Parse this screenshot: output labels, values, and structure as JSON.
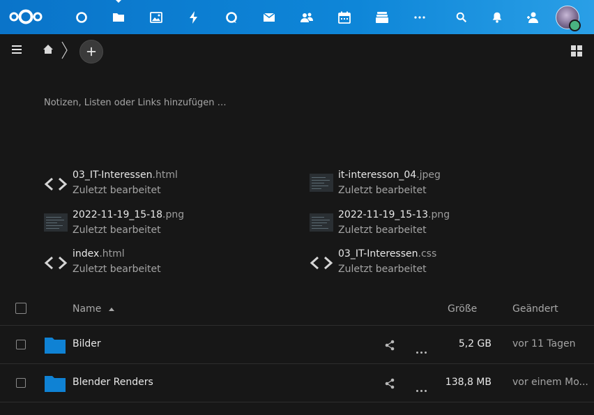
{
  "header": {
    "apps": [
      {
        "name": "dashboard"
      },
      {
        "name": "files"
      },
      {
        "name": "photos"
      },
      {
        "name": "activity"
      },
      {
        "name": "talk"
      },
      {
        "name": "mail"
      },
      {
        "name": "contacts"
      },
      {
        "name": "calendar"
      },
      {
        "name": "deck"
      },
      {
        "name": "more-apps"
      }
    ]
  },
  "toolbar": {
    "new_label": "+"
  },
  "notes": {
    "placeholder": "Notizen, Listen oder Links hinzufügen …"
  },
  "recent": [
    {
      "base": "03_IT-Interessen",
      "ext": ".html",
      "sub": "Zuletzt bearbeitet",
      "kind": "code"
    },
    {
      "base": "it-interesson_04",
      "ext": ".jpeg",
      "sub": "Zuletzt bearbeitet",
      "kind": "image"
    },
    {
      "base": "2022-11-19_15-18",
      "ext": ".png",
      "sub": "Zuletzt bearbeitet",
      "kind": "image"
    },
    {
      "base": "2022-11-19_15-13",
      "ext": ".png",
      "sub": "Zuletzt bearbeitet",
      "kind": "image"
    },
    {
      "base": "index",
      "ext": ".html",
      "sub": "Zuletzt bearbeitet",
      "kind": "code"
    },
    {
      "base": "03_IT-Interessen",
      "ext": ".css",
      "sub": "Zuletzt bearbeitet",
      "kind": "code"
    }
  ],
  "list": {
    "col_name": "Name",
    "col_size": "Größe",
    "col_modified": "Geändert",
    "rows": [
      {
        "name": "Bilder",
        "size": "5,2 GB",
        "modified": "vor 11 Tagen"
      },
      {
        "name": "Blender Renders",
        "size": "138,8 MB",
        "modified": "vor einem Mo..."
      }
    ]
  },
  "colors": {
    "header_start": "#0a74c9",
    "header_end": "#2a9fe6",
    "folder": "#0f82d4",
    "background": "#171717"
  }
}
